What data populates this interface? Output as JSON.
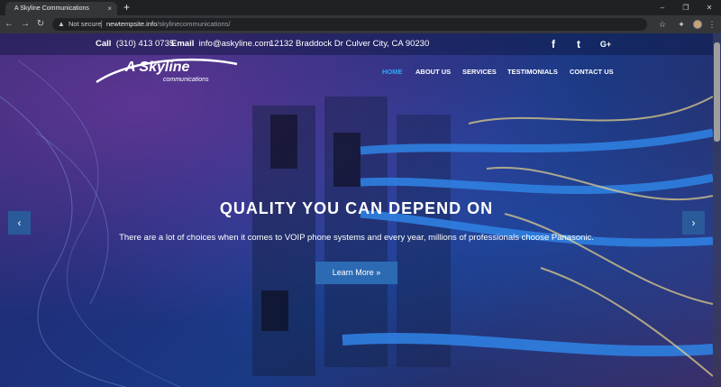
{
  "browser": {
    "tab_title": "A Skyline Communications",
    "tab_close": "×",
    "new_tab": "+",
    "not_secure": "Not secure",
    "url_host": "newtempsite.info",
    "url_path": "/skylinecommunications/",
    "window_controls": [
      "–",
      "❐",
      "✕"
    ]
  },
  "site": {
    "top_bar": {
      "call_label": "Call",
      "phone": "(310) 413 0735",
      "email_label": "Email",
      "email": "info@askyline.com",
      "address": "12132 Braddock Dr Culver City, CA 90230",
      "social": [
        "f",
        "t",
        "G+"
      ]
    },
    "logo": {
      "main": "A Skyline",
      "sub": "communications"
    },
    "nav": [
      "HOME",
      "ABOUT US",
      "SERVICES",
      "TESTIMONIALS",
      "CONTACT US"
    ],
    "hero": {
      "headline": "QUALITY YOU CAN DEPEND ON",
      "subtext": "There are a lot of choices when it comes to VOIP phone systems and every year, millions of professionals choose Panasonic.",
      "cta": "Learn More  »"
    },
    "slider": {
      "prev": "‹",
      "next": "›"
    }
  }
}
